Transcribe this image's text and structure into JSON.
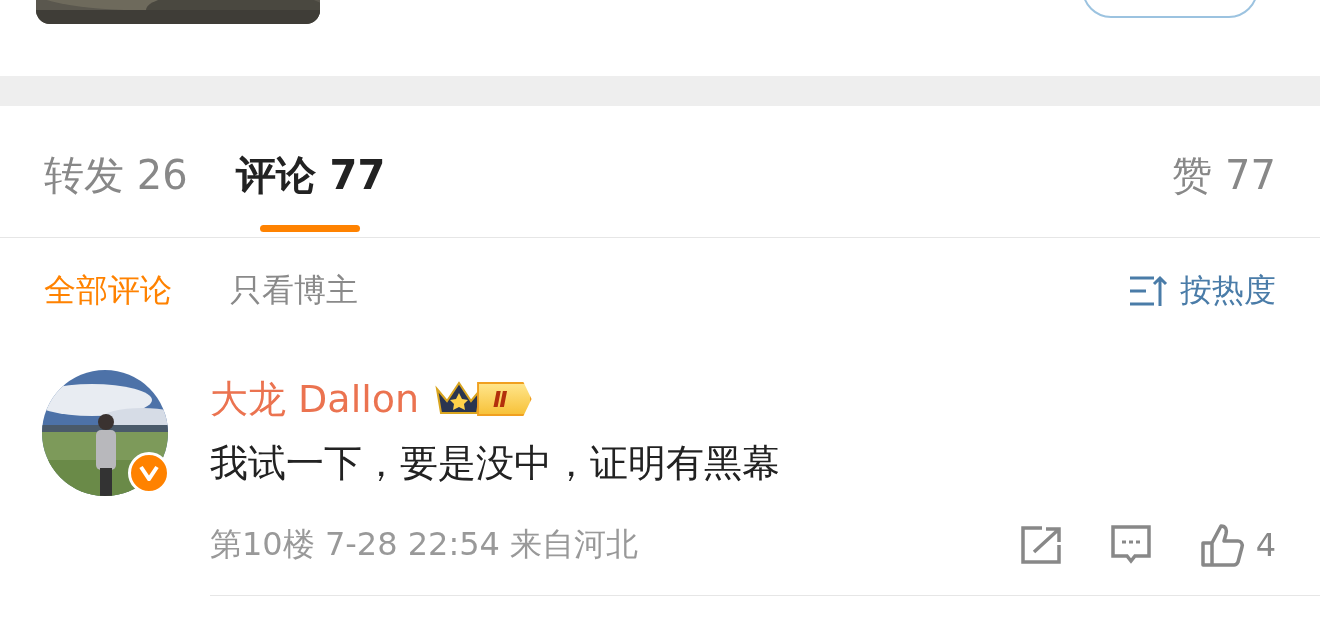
{
  "tabs": [
    {
      "label": "转发",
      "count": "26",
      "selected": false
    },
    {
      "label": "评论",
      "count": "77",
      "selected": true
    }
  ],
  "likes": {
    "label": "赞",
    "count": "77"
  },
  "filters": [
    {
      "label": "全部评论",
      "selected": true
    },
    {
      "label": "只看博主",
      "selected": false
    }
  ],
  "sort": {
    "label": "按热度"
  },
  "comments": [
    {
      "author": "大龙 Dallon",
      "badge": "Ⅱ",
      "verified": true,
      "text": "我试一下，要是没中，证明有黑幕",
      "meta": "第10楼 7-28 22:54 来自河北",
      "likes": "4"
    }
  ]
}
